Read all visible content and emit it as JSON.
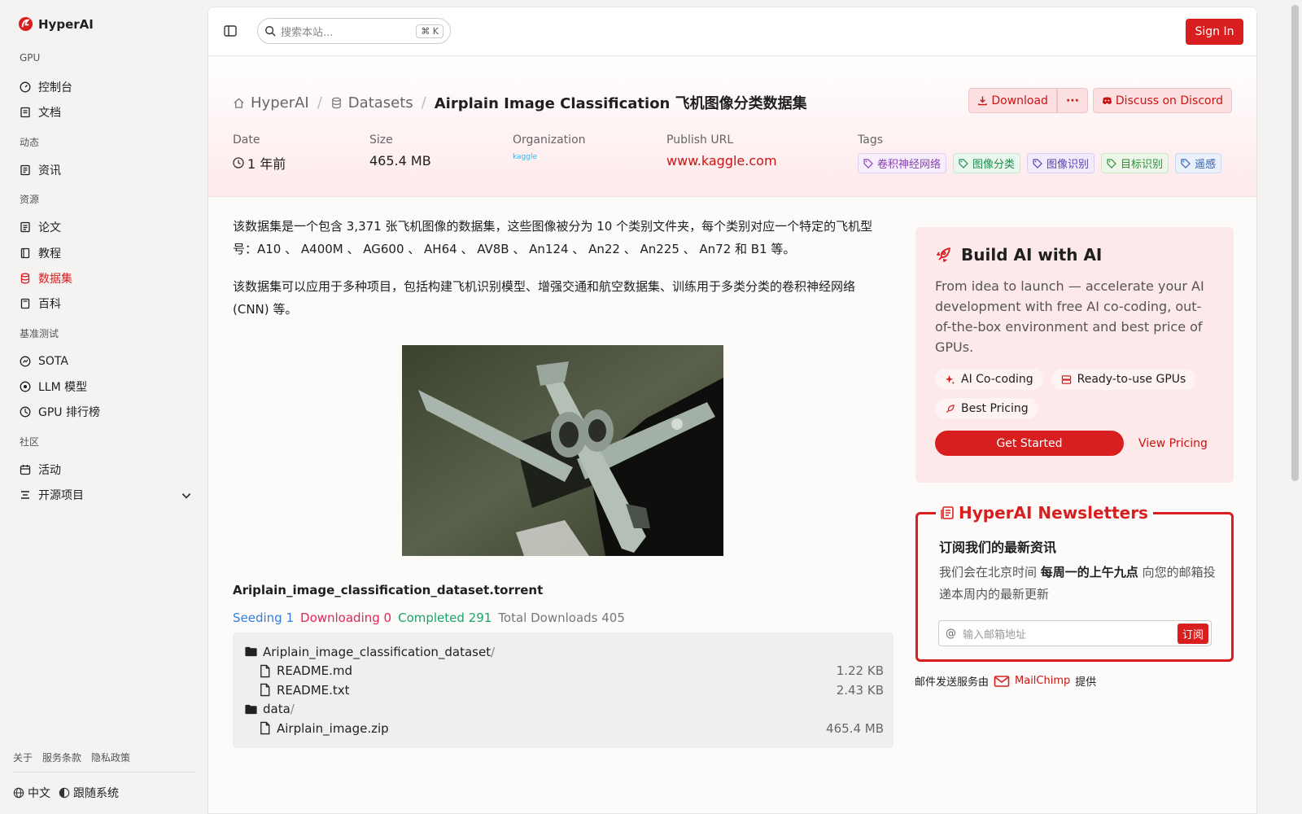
{
  "app": {
    "name": "HyperAI"
  },
  "sidebar": {
    "sections": [
      {
        "title": "GPU",
        "items": [
          {
            "label": "控制台",
            "icon": "gauge-icon"
          },
          {
            "label": "文档",
            "icon": "doc-icon"
          }
        ]
      },
      {
        "title": "动态",
        "items": [
          {
            "label": "资讯",
            "icon": "news-icon"
          }
        ]
      },
      {
        "title": "资源",
        "items": [
          {
            "label": "论文",
            "icon": "paper-icon"
          },
          {
            "label": "教程",
            "icon": "book-icon"
          },
          {
            "label": "数据集",
            "icon": "database-icon",
            "active": true
          },
          {
            "label": "百科",
            "icon": "encyclopedia-icon"
          }
        ]
      },
      {
        "title": "基准测试",
        "items": [
          {
            "label": "SOTA",
            "icon": "chart-icon"
          },
          {
            "label": "LLM 模型",
            "icon": "llm-icon"
          },
          {
            "label": "GPU 排行榜",
            "icon": "leaderboard-icon"
          }
        ]
      },
      {
        "title": "社区",
        "items": [
          {
            "label": "活动",
            "icon": "calendar-icon"
          },
          {
            "label": "开源项目",
            "icon": "list-icon"
          }
        ]
      }
    ],
    "footer_links": [
      "关于",
      "服务条款",
      "隐私政策"
    ],
    "language": "中文",
    "theme": "跟随系统"
  },
  "topbar": {
    "search_placeholder": "搜索本站...",
    "shortcut": "K",
    "signin_label": "Sign In"
  },
  "header": {
    "breadcrumb": {
      "home": "HyperAI",
      "section": "Datasets",
      "current": "Airplain Image Classification 飞机图像分类数据集"
    },
    "download_label": "Download",
    "more_label": "···",
    "discord_label": "Discuss on Discord",
    "meta": {
      "date_label": "Date",
      "date_value": "1 年前",
      "size_label": "Size",
      "size_value": "465.4 MB",
      "org_label": "Organization",
      "org_value": "kaggle",
      "url_label": "Publish URL",
      "url_value": "www.kaggle.com",
      "tags_label": "Tags"
    },
    "tags": [
      {
        "label": "卷积神经网络",
        "color": "#8b3fb5",
        "bg": "#f6eefb",
        "border": "#e2cdf0"
      },
      {
        "label": "图像分类",
        "color": "#1f8a4c",
        "bg": "#eaf7ef",
        "border": "#c6e8d3"
      },
      {
        "label": "图像识别",
        "color": "#5b3fb5",
        "bg": "#f0ecfb",
        "border": "#d8cef2"
      },
      {
        "label": "目标识别",
        "color": "#2f8f3a",
        "bg": "#ecf7ea",
        "border": "#cbe8c6"
      },
      {
        "label": "遥感",
        "color": "#2f5fb5",
        "bg": "#eaf1fb",
        "border": "#c9daf2"
      }
    ]
  },
  "content": {
    "para1": "该数据集是一个包含 3,371 张飞机图像的数据集，这些图像被分为 10 个类别文件夹，每个类别对应一个特定的飞机型号：A10 、 A400M 、 AG600 、 AH64 、 AV8B 、 An124 、 An22 、 An225 、 An72 和 B1 等。",
    "para2": "该数据集可以应用于多种项目，包括构建飞机识别模型、增强交通和航空数据集、训练用于多类分类的卷积神经网络 (CNN) 等。",
    "torrent_name": "Ariplain_image_classification_dataset.torrent",
    "stats": {
      "seeding": "Seeding 1",
      "downloading": "Downloading 0",
      "completed": "Completed 291",
      "total": "Total Downloads 405",
      "colors": {
        "seeding": "#2f7fe0",
        "downloading": "#e0245e",
        "completed": "#17a56b",
        "total": "#777777"
      }
    },
    "files": [
      {
        "type": "folder",
        "name": "Ariplain_image_classification_dataset",
        "suffix": "/",
        "indent": false,
        "size": ""
      },
      {
        "type": "file",
        "name": "README.md",
        "suffix": "",
        "indent": true,
        "size": "1.22 KB"
      },
      {
        "type": "file",
        "name": "README.txt",
        "suffix": "",
        "indent": true,
        "size": "2.43 KB"
      },
      {
        "type": "folder",
        "name": "data",
        "suffix": "/",
        "indent": false,
        "size": ""
      },
      {
        "type": "file",
        "name": "Airplain_image.zip",
        "suffix": "",
        "indent": true,
        "size": "465.4 MB"
      }
    ]
  },
  "promo": {
    "title": "Build AI with AI",
    "desc": "From idea to launch — accelerate your AI development with free AI co-coding, out-of-the-box environment and best price of GPUs.",
    "chips": [
      "AI Co-coding",
      "Ready-to-use GPUs",
      "Best Pricing"
    ],
    "cta": "Get Started",
    "pricing": "View Pricing"
  },
  "newsletter": {
    "title": "HyperAI Newsletters",
    "subtitle": "订阅我们的最新资讯",
    "desc_before": "我们会在北京时间",
    "desc_bold": "每周一的上午九点",
    "desc_after": "向您的邮箱投递本周内的最新更新",
    "placeholder": "输入邮箱地址",
    "subscribe": "订阅",
    "provider_before": "邮件发送服务由",
    "provider_name": "MailChimp",
    "provider_after": "提供"
  },
  "colors": {
    "accent": "#d81e1e"
  }
}
